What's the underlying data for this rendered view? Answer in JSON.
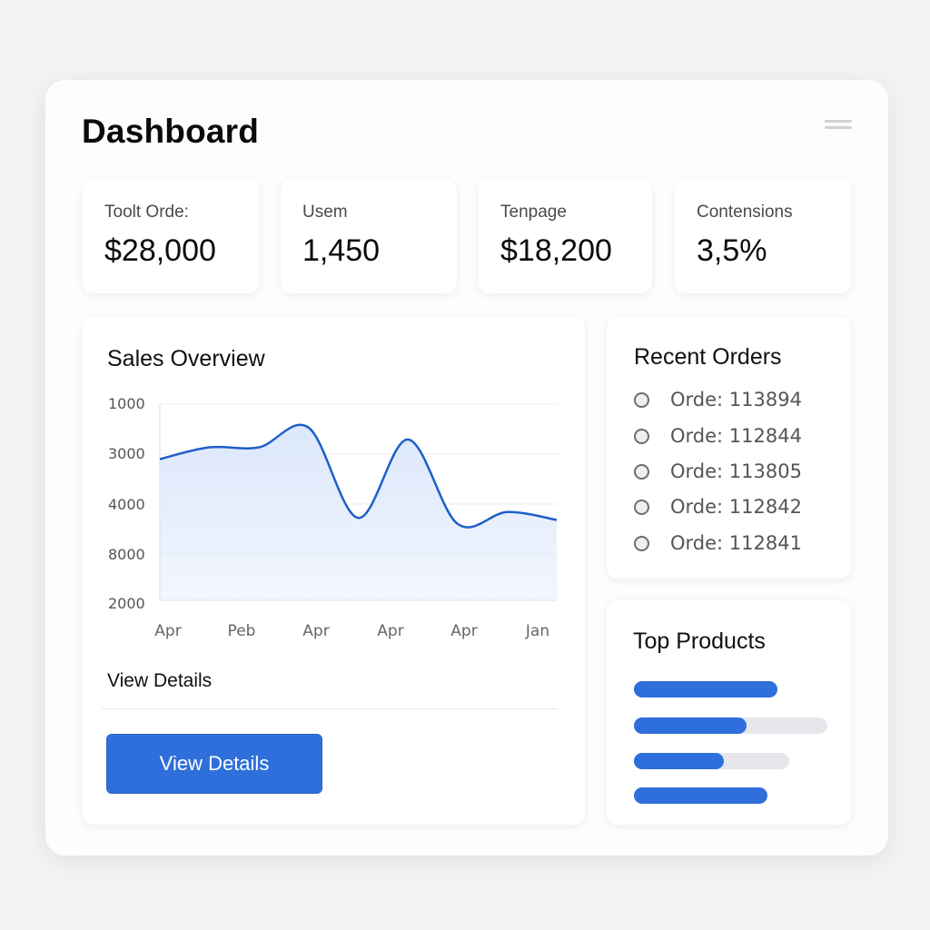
{
  "header": {
    "title": "Dashboard",
    "menu_icon": "hamburger-menu-icon"
  },
  "stats": [
    {
      "label": "Toolt Orde:",
      "value": "$28,000"
    },
    {
      "label": "Usem",
      "value": "1,450"
    },
    {
      "label": "Tenpage",
      "value": "$18,200"
    },
    {
      "label": "Contensions",
      "value": "3,5%"
    }
  ],
  "sales": {
    "title": "Sales Overview",
    "link_label": "View Details",
    "button_label": "View Details"
  },
  "chart_data": {
    "type": "area",
    "title": "Sales Overview",
    "y_tick_labels": [
      "1000",
      "3000",
      "4000",
      "8000",
      "2000"
    ],
    "x_tick_labels": [
      "Apr",
      "Peb",
      "Apr",
      "Apr",
      "Apr",
      "Jan"
    ],
    "y_positions_fraction": [
      0.72,
      0.78,
      0.78,
      0.88,
      0.42,
      0.82,
      0.39,
      0.45,
      0.41
    ],
    "line_color": "#1f5fc8",
    "fill_color": "#dbe7fb",
    "grid": true
  },
  "recent_orders": {
    "title": "Recent Orders",
    "items": [
      "Orde: 113894",
      "Orde: 112844",
      "Orde: 113805",
      "Orde: 112842",
      "Orde: 112841"
    ]
  },
  "top_products": {
    "title": "Top Products",
    "bars": [
      {
        "fill": 1.0
      },
      {
        "fill": 0.58
      },
      {
        "fill": 0.58
      },
      {
        "fill": 1.0
      }
    ]
  },
  "colors": {
    "accent": "#2e6fdb",
    "background": "#f2f3f5",
    "card": "#ffffff"
  }
}
